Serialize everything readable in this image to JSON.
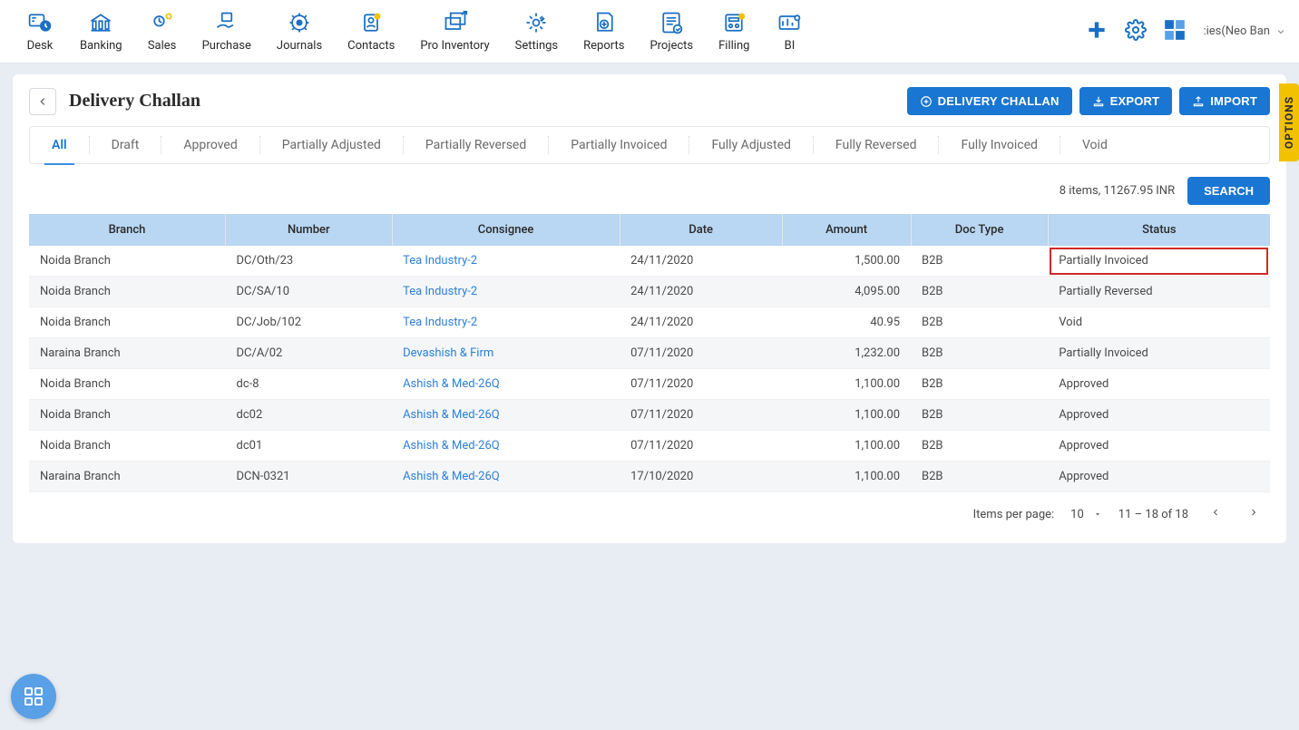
{
  "topnav": {
    "items": [
      {
        "label": "Desk"
      },
      {
        "label": "Banking"
      },
      {
        "label": "Sales"
      },
      {
        "label": "Purchase"
      },
      {
        "label": "Journals"
      },
      {
        "label": "Contacts"
      },
      {
        "label": "Pro Inventory"
      },
      {
        "label": "Settings"
      },
      {
        "label": "Reports"
      },
      {
        "label": "Projects"
      },
      {
        "label": "Filling"
      },
      {
        "label": "BI"
      }
    ],
    "company_label": ":ies(Neo Ban"
  },
  "page": {
    "title": "Delivery Challan",
    "actions": {
      "new": "DELIVERY CHALLAN",
      "export": "EXPORT",
      "import": "IMPORT"
    }
  },
  "tabs": [
    "All",
    "Draft",
    "Approved",
    "Partially Adjusted",
    "Partially Reversed",
    "Partially Invoiced",
    "Fully Adjusted",
    "Fully Reversed",
    "Fully Invoiced",
    "Void"
  ],
  "summary": "8 items, 11267.95 INR",
  "search_label": "SEARCH",
  "table": {
    "headers": [
      "Branch",
      "Number",
      "Consignee",
      "Date",
      "Amount",
      "Doc Type",
      "Status"
    ],
    "rows": [
      {
        "branch": "Noida Branch",
        "number": "DC/Oth/23",
        "consignee": "Tea Industry-2",
        "date": "24/11/2020",
        "amount": "1,500.00",
        "doctype": "B2B",
        "status": "Partially Invoiced",
        "highlight": true
      },
      {
        "branch": "Noida Branch",
        "number": "DC/SA/10",
        "consignee": "Tea Industry-2",
        "date": "24/11/2020",
        "amount": "4,095.00",
        "doctype": "B2B",
        "status": "Partially Reversed"
      },
      {
        "branch": "Noida Branch",
        "number": "DC/Job/102",
        "consignee": "Tea Industry-2",
        "date": "24/11/2020",
        "amount": "40.95",
        "doctype": "B2B",
        "status": "Void"
      },
      {
        "branch": "Naraina Branch",
        "number": "DC/A/02",
        "consignee": "Devashish & Firm",
        "date": "07/11/2020",
        "amount": "1,232.00",
        "doctype": "B2B",
        "status": "Partially Invoiced"
      },
      {
        "branch": "Noida Branch",
        "number": "dc-8",
        "consignee": "Ashish & Med-26Q",
        "date": "07/11/2020",
        "amount": "1,100.00",
        "doctype": "B2B",
        "status": "Approved"
      },
      {
        "branch": "Noida Branch",
        "number": "dc02",
        "consignee": "Ashish & Med-26Q",
        "date": "07/11/2020",
        "amount": "1,100.00",
        "doctype": "B2B",
        "status": "Approved"
      },
      {
        "branch": "Noida Branch",
        "number": "dc01",
        "consignee": "Ashish & Med-26Q",
        "date": "07/11/2020",
        "amount": "1,100.00",
        "doctype": "B2B",
        "status": "Approved"
      },
      {
        "branch": "Naraina Branch",
        "number": "DCN-0321",
        "consignee": "Ashish & Med-26Q",
        "date": "17/10/2020",
        "amount": "1,100.00",
        "doctype": "B2B",
        "status": "Approved"
      }
    ]
  },
  "pagination": {
    "per_page_label": "Items per page:",
    "per_page_value": "10",
    "range": "11 – 18 of 18"
  },
  "options_tab": "OPTIONS"
}
